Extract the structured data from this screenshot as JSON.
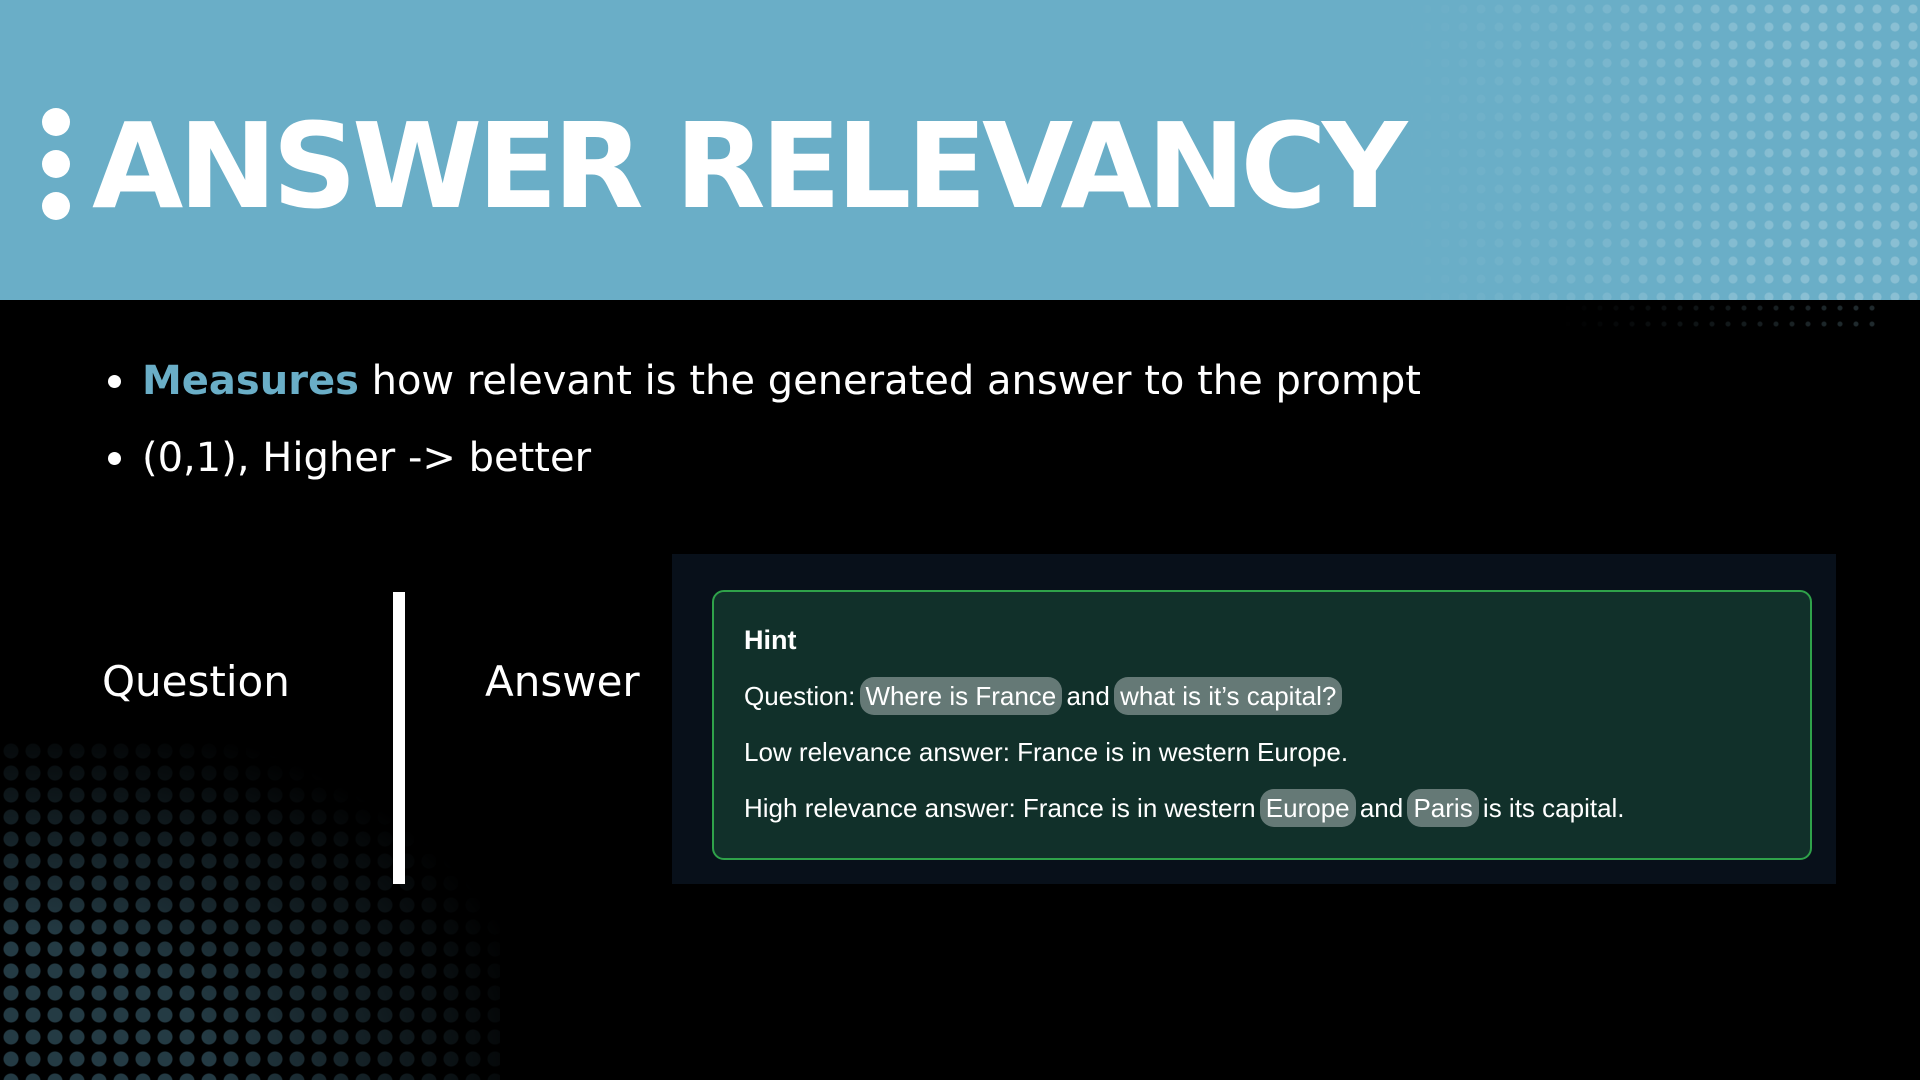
{
  "header": {
    "title": "ANSWER RELEVANCY",
    "background_color": "#6aaec7"
  },
  "bullets": [
    {
      "accent": "Measures",
      "text": " how relevant is the generated answer to the prompt"
    },
    {
      "accent": "",
      "text": "(0,1), Higher -> better"
    }
  ],
  "qa": {
    "question_label": "Question",
    "answer_label": "Answer"
  },
  "hint": {
    "title": "Hint",
    "question": {
      "prefix": "Question: ",
      "highlight1": "Where is France",
      "middle": " and ",
      "highlight2": "what is it’s capital?"
    },
    "low": "Low relevance answer: France is in western Europe.",
    "high": {
      "prefix": "High relevance answer: France is in western ",
      "highlight1": "Europe",
      "middle": " and ",
      "highlight2": "Paris",
      "suffix": " is its capital."
    },
    "border_color": "#2fa24a",
    "background_color": "#11302a"
  },
  "colors": {
    "accent": "#6aaec7",
    "background": "#000000"
  }
}
